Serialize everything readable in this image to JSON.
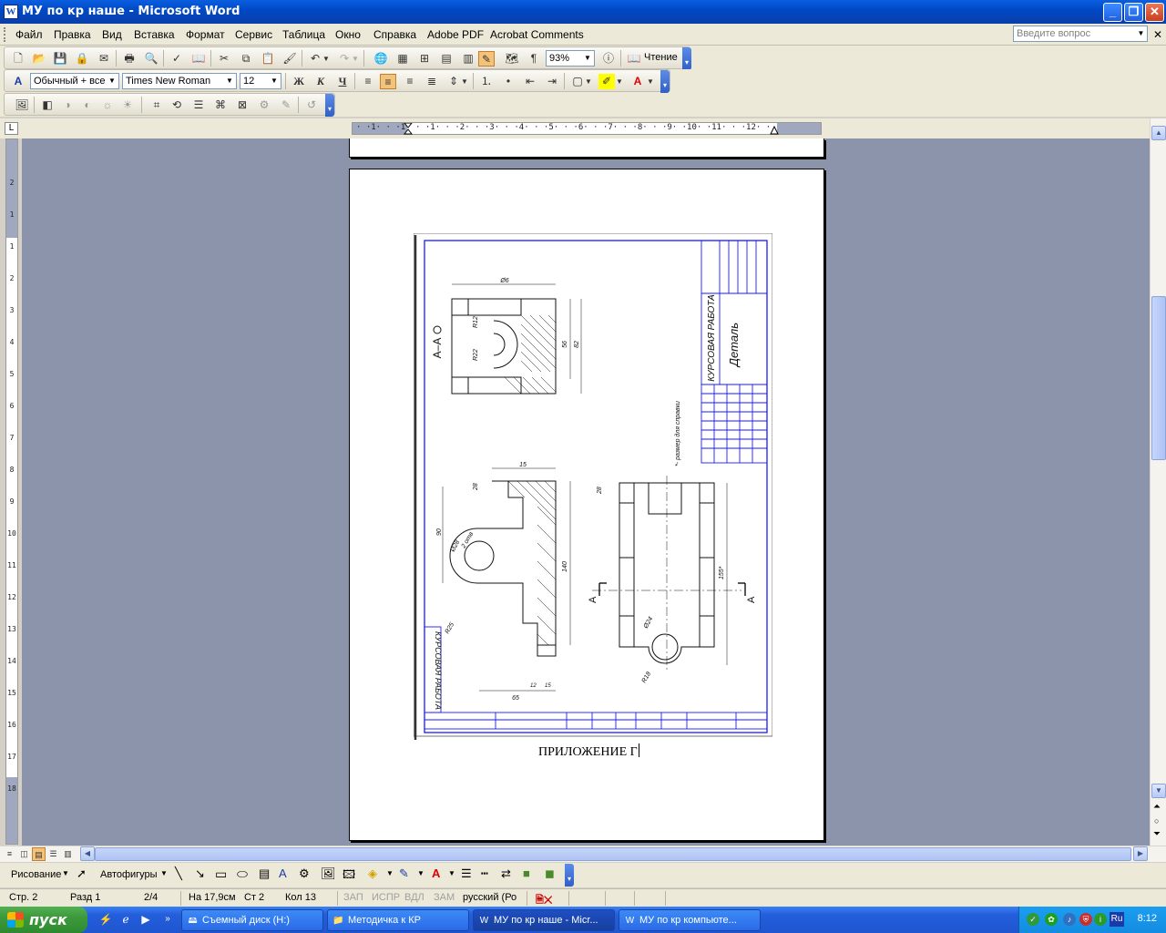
{
  "window": {
    "title": "МУ по кр наше - Microsoft Word"
  },
  "menu": {
    "items": [
      "Файл",
      "Правка",
      "Вид",
      "Вставка",
      "Формат",
      "Сервис",
      "Таблица",
      "Окно",
      "Справка",
      "Adobe PDF",
      "Acrobat Comments"
    ],
    "ask_placeholder": "Введите вопрос"
  },
  "toolbar": {
    "zoom": "93%",
    "reading_label": "Чтение",
    "style": "Обычный + все",
    "font": "Times New Roman",
    "size": "12"
  },
  "ruler": {
    "h_numbers": "· ·1· · ·1· · ·1· · ·2· · ·3· · ·4· · ·5· · ·6· · ·7· · ·8· · ·9· ·10· ·11· · ·12· ·",
    "v_numbers": [
      "2",
      "1",
      "1",
      "2",
      "3",
      "4",
      "5",
      "6",
      "7",
      "8",
      "9",
      "10",
      "11",
      "12",
      "13",
      "14",
      "15",
      "16",
      "17",
      "18"
    ]
  },
  "document": {
    "caption": "ПРИЛОЖЕНИЕ Г",
    "drawing": {
      "section_label": "А–А",
      "stamp_title": "КУРСОВАЯ РАБОТА",
      "stamp_part": "Деталь",
      "side_label": "КУРСОВАЯ РАБОТА",
      "note": "*- размер для справки",
      "dims": [
        "Ø6",
        "R12",
        "R22",
        "56",
        "82",
        "15",
        "28",
        "90",
        "Ø28",
        "2 отв",
        "140",
        "R25",
        "65",
        "15",
        "12",
        "28",
        "155*",
        "Ø24",
        "R18"
      ],
      "cut_marks": [
        "А",
        "А"
      ]
    }
  },
  "drawing_toolbar": {
    "draw_label": "Рисование",
    "autoshapes_label": "Автофигуры"
  },
  "status": {
    "page": "Стр. 2",
    "section": "Разд 1",
    "pages": "2/4",
    "at": "На 17,9см",
    "line": "Ст 2",
    "col": "Кол 13",
    "rec": "ЗАП",
    "trk": "ИСПР",
    "ext": "ВДЛ",
    "ovr": "ЗАМ",
    "lang": "русский (Ро"
  },
  "taskbar": {
    "start_label": "пуск",
    "tasks": [
      "Съемный диск (H:)",
      "Методичка к КР",
      "МУ по кр наше - Micr...",
      "МУ по кр компьюте..."
    ],
    "lang": "Ru",
    "clock": "8:12"
  },
  "colors": {
    "drawing_frame": "#1a1aff",
    "titlebar": "#0a5fe0",
    "doc_bg": "#8c94ac"
  }
}
